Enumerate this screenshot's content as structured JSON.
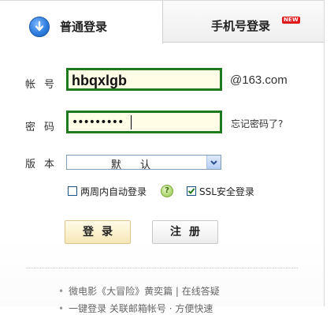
{
  "tabs": {
    "active_label": "普通登录",
    "inactive_label": "手机号登录",
    "new_badge": "NEW"
  },
  "form": {
    "account_label": "帐号",
    "account_value": "hbqxlgb",
    "account_domain": "@163.com",
    "password_label": "密码",
    "password_mask": "•••••••••",
    "forgot_label": "忘记密码了?",
    "version_label": "版本",
    "version_value": "默认",
    "auto_login_label": "两周内自动登录",
    "auto_login_checked": false,
    "ssl_label": "SSL安全登录",
    "ssl_checked": true
  },
  "buttons": {
    "login": "登录",
    "register": "注册"
  },
  "promos": [
    "微电影《大冒险》黄奕篇 | 在线答疑",
    "一键登录 关联邮箱帐号 · 方便快速"
  ],
  "colors": {
    "input_border": "#1f7a1f",
    "input_bg": "#fffde6",
    "badge": "#e01a1a",
    "login_btn": "#f6e7b6"
  },
  "icons": {
    "tab_icon": "arrow-down-circle-icon",
    "help": "question-icon",
    "dropdown": "chevron-down-icon"
  }
}
